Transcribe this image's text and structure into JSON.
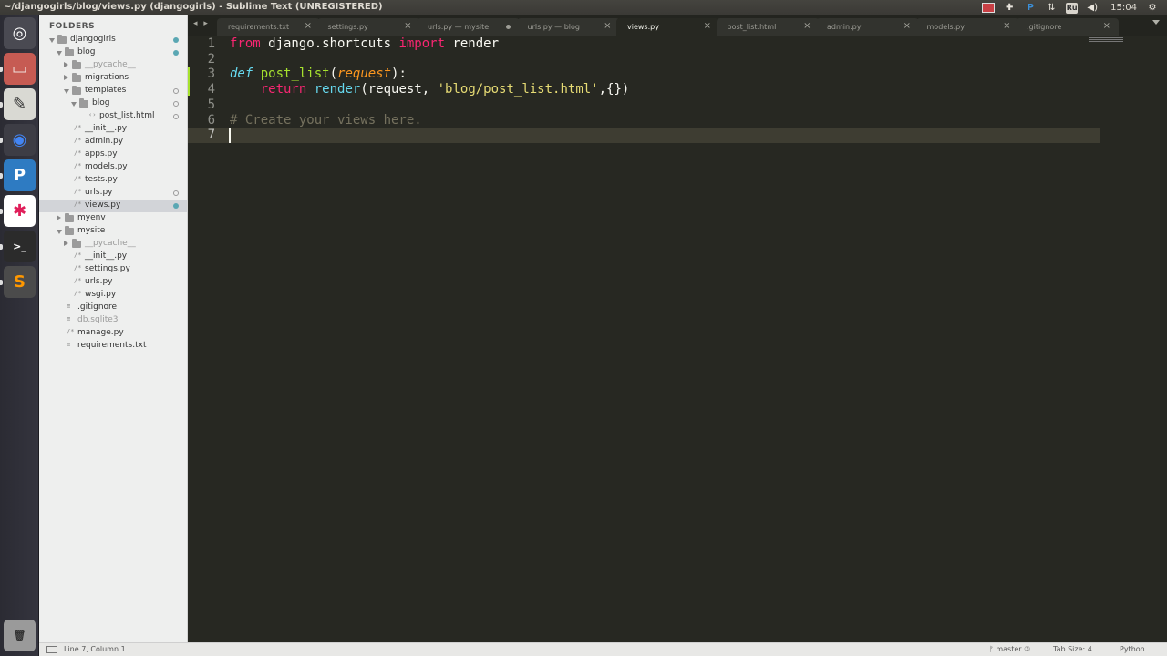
{
  "window": {
    "title": "~/djangogirls/blog/views.py (djangogirls) - Sublime Text (UNREGISTERED)"
  },
  "tray": {
    "keyboard_layout": "Ru",
    "time": "15:04"
  },
  "launcher": [
    {
      "name": "Ubuntu Dash",
      "glyph": "◎",
      "bg": "#4a4a52",
      "color": "#ffffff"
    },
    {
      "name": "Files",
      "glyph": "▭",
      "bg": "#c65b53",
      "color": "#f0e0dc"
    },
    {
      "name": "Text Editor",
      "glyph": "✎",
      "bg": "#d9d9d3",
      "color": "#333333"
    },
    {
      "name": "Chrome",
      "glyph": "◉",
      "bg": "#3d3d45",
      "color": "#4285f4"
    },
    {
      "name": "PyCharm",
      "glyph": "P",
      "bg": "#2e7bc2",
      "color": "#ffffff"
    },
    {
      "name": "Slack",
      "glyph": "✱",
      "bg": "#ffffff",
      "color": "#e01e5a"
    },
    {
      "name": "Terminal",
      "glyph": ">_",
      "bg": "#2b2b2b",
      "color": "#ffffff"
    },
    {
      "name": "Sublime Text",
      "glyph": "S",
      "bg": "#4b4b4b",
      "color": "#ff9800"
    },
    {
      "name": "Trash",
      "glyph": "🗑",
      "bg": "#9a9a9a",
      "color": "#333333"
    }
  ],
  "sidebar": {
    "header": "FOLDERS",
    "tree": [
      {
        "label": "djangogirls",
        "type": "folder",
        "open": true,
        "depth": 0,
        "dot": "filled"
      },
      {
        "label": "blog",
        "type": "folder",
        "open": true,
        "depth": 1,
        "dot": "filled"
      },
      {
        "label": "__pycache__",
        "type": "folder",
        "open": false,
        "depth": 2,
        "dim": true
      },
      {
        "label": "migrations",
        "type": "folder",
        "open": false,
        "depth": 2
      },
      {
        "label": "templates",
        "type": "folder",
        "open": true,
        "depth": 2,
        "dot": "hollow"
      },
      {
        "label": "blog",
        "type": "folder",
        "open": true,
        "depth": 3,
        "dot": "hollow"
      },
      {
        "label": "post_list.html",
        "type": "html",
        "depth": 4,
        "dot": "hollow"
      },
      {
        "label": "__init__.py",
        "type": "py",
        "depth": 2
      },
      {
        "label": "admin.py",
        "type": "py",
        "depth": 2
      },
      {
        "label": "apps.py",
        "type": "py",
        "depth": 2
      },
      {
        "label": "models.py",
        "type": "py",
        "depth": 2
      },
      {
        "label": "tests.py",
        "type": "py",
        "depth": 2
      },
      {
        "label": "urls.py",
        "type": "py",
        "depth": 2,
        "dot": "hollow"
      },
      {
        "label": "views.py",
        "type": "py",
        "depth": 2,
        "dot": "filled",
        "selected": true
      },
      {
        "label": "myenv",
        "type": "folder",
        "open": false,
        "depth": 1
      },
      {
        "label": "mysite",
        "type": "folder",
        "open": true,
        "depth": 1
      },
      {
        "label": "__pycache__",
        "type": "folder",
        "open": false,
        "depth": 2,
        "dim": true
      },
      {
        "label": "__init__.py",
        "type": "py",
        "depth": 2
      },
      {
        "label": "settings.py",
        "type": "py",
        "depth": 2
      },
      {
        "label": "urls.py",
        "type": "py",
        "depth": 2
      },
      {
        "label": "wsgi.py",
        "type": "py",
        "depth": 2
      },
      {
        "label": ".gitignore",
        "type": "txt",
        "depth": 1
      },
      {
        "label": "db.sqlite3",
        "type": "txt",
        "depth": 1,
        "dim": true
      },
      {
        "label": "manage.py",
        "type": "py",
        "depth": 1
      },
      {
        "label": "requirements.txt",
        "type": "txt",
        "depth": 1
      }
    ]
  },
  "tabs": [
    {
      "label": "requirements.txt",
      "state": "close"
    },
    {
      "label": "settings.py",
      "state": "close"
    },
    {
      "label": "urls.py — mysite",
      "state": "modified"
    },
    {
      "label": "urls.py — blog",
      "state": "close"
    },
    {
      "label": "views.py",
      "state": "close",
      "active": true
    },
    {
      "label": "post_list.html",
      "state": "close"
    },
    {
      "label": "admin.py",
      "state": "close"
    },
    {
      "label": "models.py",
      "state": "close"
    },
    {
      "label": ".gitignore",
      "state": "close"
    }
  ],
  "tab_nav": "◂ ▸",
  "editor": {
    "lines": [
      [
        {
          "t": "from",
          "c": "kw"
        },
        {
          "t": " django.shortcuts "
        },
        {
          "t": "import",
          "c": "kw"
        },
        {
          "t": " render"
        }
      ],
      [],
      [
        {
          "t": "def",
          "c": "def"
        },
        {
          "t": " "
        },
        {
          "t": "post_list",
          "c": "fn"
        },
        {
          "t": "("
        },
        {
          "t": "request",
          "c": "param"
        },
        {
          "t": "):"
        }
      ],
      [
        {
          "t": "    "
        },
        {
          "t": "return",
          "c": "kw"
        },
        {
          "t": " "
        },
        {
          "t": "render",
          "c": "call"
        },
        {
          "t": "(request, "
        },
        {
          "t": "'blog/post_list.html'",
          "c": "str"
        },
        {
          "t": ",{})"
        }
      ],
      [],
      [
        {
          "t": "# Create your views here.",
          "c": "cmt"
        }
      ],
      []
    ],
    "current_line": 7
  },
  "status": {
    "position": "Line 7, Column 1",
    "git": "ᚠ master ③",
    "tab_size": "Tab Size: 4",
    "syntax": "Python"
  }
}
